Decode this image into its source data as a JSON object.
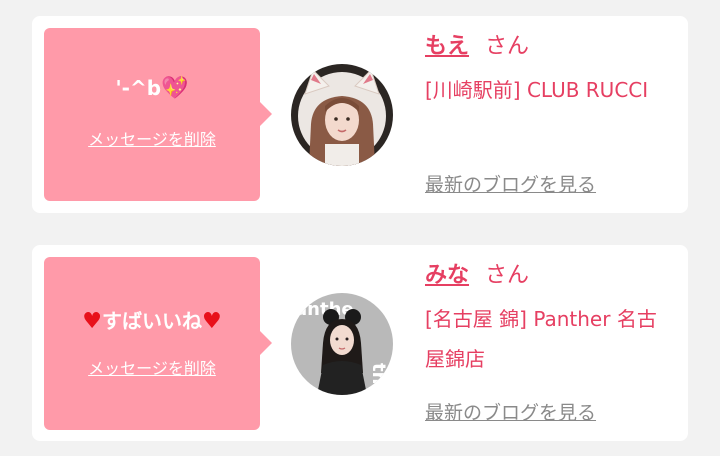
{
  "colors": {
    "accent": "#e63f62",
    "bubble": "#ff9aa9",
    "heart": "#e8101a"
  },
  "cards": [
    {
      "message": "'-^b",
      "delete_label": "メッセージを削除",
      "name": "もえ",
      "honorific": "さん",
      "shop": "[川崎駅前] CLUB RUCCI",
      "blog_link": "最新のブログを見る",
      "avatar_icon": "avatar-photo-icon"
    },
    {
      "message": "すばいいね",
      "delete_label": "メッセージを削除",
      "name": "みな",
      "honorific": "さん",
      "shop": "[名古屋 錦] Panther 名古屋錦店",
      "blog_link": "最新のブログを見る",
      "avatar_icon": "avatar-photo-icon"
    }
  ]
}
